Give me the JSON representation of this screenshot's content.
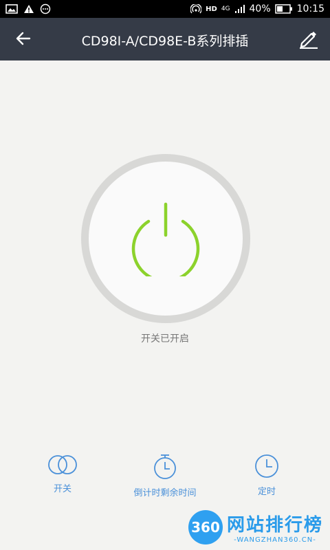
{
  "status_bar": {
    "battery": "40%",
    "time": "10:15",
    "network": "4G",
    "hd": "HD",
    "icons": [
      "image-icon",
      "warning-icon",
      "message-icon",
      "hotspot-icon",
      "signal-icon",
      "battery-icon"
    ]
  },
  "header": {
    "title": "CD98I-A/CD98E-B系列排插",
    "back_icon": "back-arrow-icon",
    "edit_icon": "edit-pencil-icon"
  },
  "power": {
    "status_text": "开关已开启",
    "icon": "power-icon",
    "color": "#8cd22c"
  },
  "bottom_actions": [
    {
      "label": "开关",
      "icon": "toggle-icon"
    },
    {
      "label": "倒计时剩余时间",
      "icon": "stopwatch-icon"
    },
    {
      "label": "定时",
      "icon": "clock-icon"
    }
  ],
  "watermark": {
    "logo": "360",
    "cn": "网站排行榜",
    "en": "-WANGZHAN360.CN-"
  },
  "colors": {
    "header_bg": "#353b47",
    "accent": "#4a90d9",
    "background": "#f3f3f1"
  }
}
